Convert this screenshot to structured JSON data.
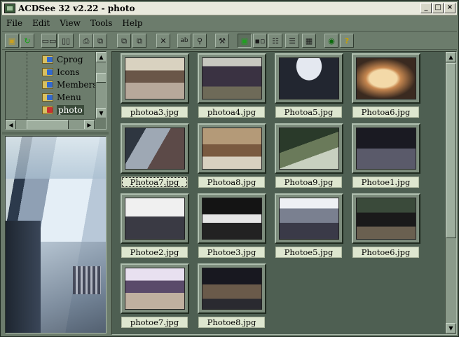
{
  "titlebar": {
    "title": "ACDSee 32 v2.22 - photo",
    "icon": "acdsee-app-icon",
    "buttons": [
      "minimize-icon",
      "maximize-icon",
      "close-icon"
    ]
  },
  "menu": [
    "File",
    "Edit",
    "View",
    "Tools",
    "Help"
  ],
  "toolbar": {
    "icons": [
      "folder-up-icon",
      "refresh-icon",
      "browse-icon",
      "view-icon",
      "print-icon",
      "copy-icon",
      "move-icon",
      "delete-icon",
      "rename-icon",
      "find-icon",
      "tools-icon",
      "thumbnails-view-icon",
      "large-icons-view-icon",
      "list-view-icon",
      "small-icons-view-icon",
      "details-view-icon",
      "preview-icon",
      "help-icon"
    ]
  },
  "tree": {
    "items": [
      {
        "label": "Cprog"
      },
      {
        "label": "Icons"
      },
      {
        "label": "Members"
      },
      {
        "label": "Menu"
      },
      {
        "label": "photo",
        "selected": true
      }
    ]
  },
  "files": [
    {
      "name": "photoa3.jpg"
    },
    {
      "name": "photoa4.jpg"
    },
    {
      "name": "Photoa5.jpg"
    },
    {
      "name": "Photoa6.jpg"
    },
    {
      "name": "Photoa7.jpg",
      "focused": true
    },
    {
      "name": "Photoa8.jpg"
    },
    {
      "name": "Photoa9.jpg"
    },
    {
      "name": "Photoe1.jpg"
    },
    {
      "name": "Photoe2.jpg"
    },
    {
      "name": "Photoe3.jpg"
    },
    {
      "name": "Photoe5.jpg"
    },
    {
      "name": "Photoe6.jpg"
    },
    {
      "name": "photoe7.jpg"
    },
    {
      "name": "Photoe8.jpg"
    }
  ],
  "colors": {
    "window": "#6c7c6c",
    "pane": "#4e5f52",
    "label_bg": "#dde6cf"
  }
}
